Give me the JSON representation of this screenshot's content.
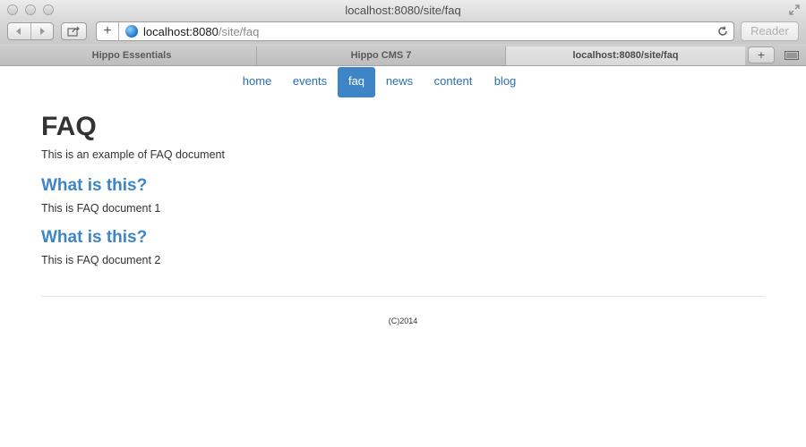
{
  "window": {
    "title": "localhost:8080/site/faq"
  },
  "toolbar": {
    "url_host": "localhost:8080",
    "url_path": "/site/faq",
    "reader_label": "Reader",
    "add_label": "+"
  },
  "tabs": [
    {
      "label": "Hippo Essentials",
      "active": false
    },
    {
      "label": "Hippo CMS 7",
      "active": false
    },
    {
      "label": "localhost:8080/site/faq",
      "active": true
    }
  ],
  "tabbar": {
    "new_tab_label": "+"
  },
  "site_nav": {
    "items": [
      {
        "label": "home"
      },
      {
        "label": "events"
      },
      {
        "label": "faq",
        "active": true
      },
      {
        "label": "news"
      },
      {
        "label": "content"
      },
      {
        "label": "blog"
      }
    ]
  },
  "main": {
    "title": "FAQ",
    "intro": "This is an example of FAQ document",
    "faqs": [
      {
        "question": "What is this?",
        "answer": "This is FAQ document 1"
      },
      {
        "question": "What is this?",
        "answer": "This is FAQ document 2"
      }
    ]
  },
  "footer": {
    "copyright": "(C)2014"
  },
  "colors": {
    "accent": "#3d85c6",
    "text": "#333333"
  }
}
